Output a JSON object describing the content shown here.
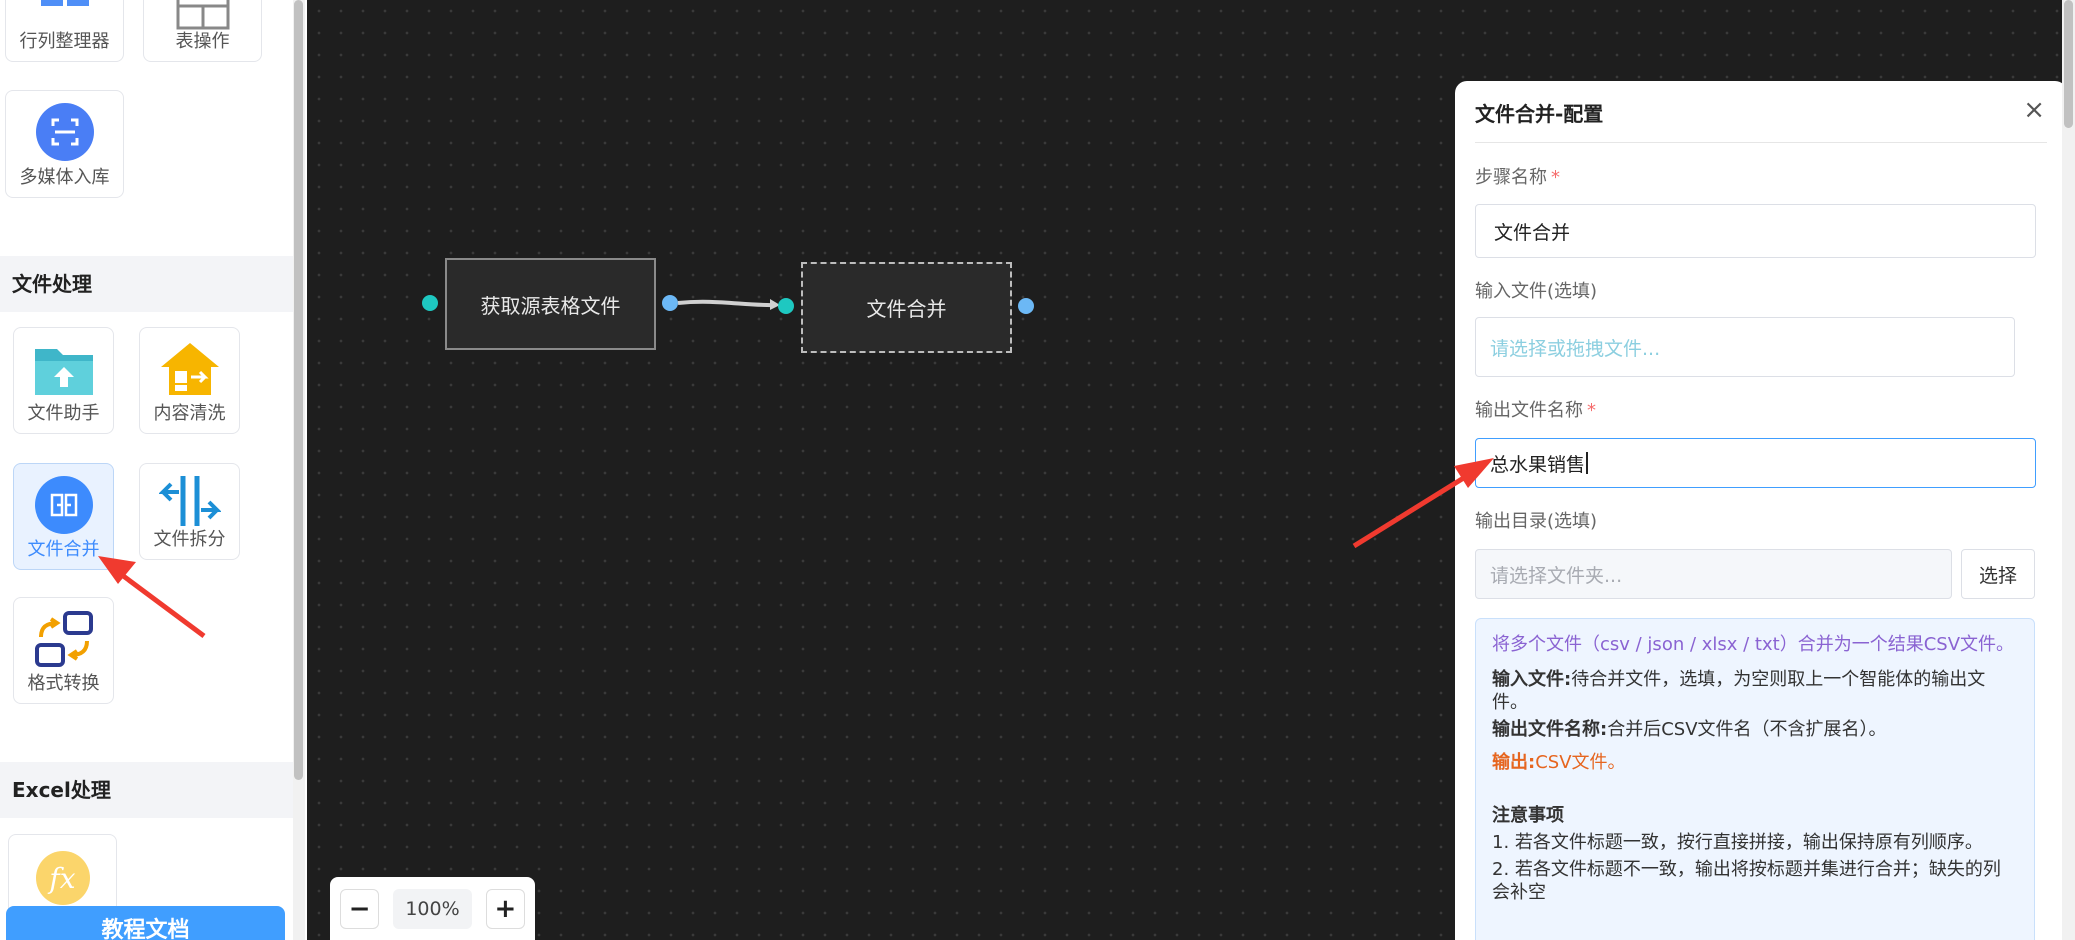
{
  "sidebar": {
    "top_tools": [
      {
        "label": "行列整理器"
      },
      {
        "label": "表操作"
      },
      {
        "label": "多媒体入库"
      }
    ],
    "sections": [
      {
        "title": "文件处理"
      },
      {
        "title": "Excel处理"
      }
    ],
    "file_tools": [
      {
        "label": "文件助手",
        "icon": "folder-upload-icon"
      },
      {
        "label": "内容清洗",
        "icon": "house-arrow-icon"
      },
      {
        "label": "文件合并",
        "icon": "merge-icon"
      },
      {
        "label": "文件拆分",
        "icon": "split-icon"
      },
      {
        "label": "格式转换",
        "icon": "convert-icon"
      }
    ],
    "excel_tools": [
      {
        "label": "fx",
        "icon": "function-icon"
      }
    ],
    "doc_button": "教程文档"
  },
  "canvas": {
    "nodes": [
      {
        "label": "获取源表格文件"
      },
      {
        "label": "文件合并"
      }
    ],
    "zoom": {
      "minus": "−",
      "value": "100%",
      "plus": "+"
    }
  },
  "panel": {
    "title": "文件合并-配置",
    "close": "×",
    "fields": {
      "step_name": {
        "label": "步骤名称",
        "required": "*",
        "value": "文件合并"
      },
      "input_file": {
        "label": "输入文件(选填)",
        "placeholder": "请选择或拖拽文件..."
      },
      "output_name": {
        "label": "输出文件名称",
        "required": "*",
        "value": "总水果销售"
      },
      "output_dir": {
        "label": "输出目录(选填)",
        "placeholder": "请选择文件夹...",
        "button": "选择"
      }
    },
    "info": {
      "summary": "将多个文件（csv / json / xlsx / txt）合并为一个结果CSV文件。",
      "input_key": "输入文件:",
      "input_desc": "待合并文件，选填，为空则取上一个智能体的输出文件。",
      "output_name_key": "输出文件名称:",
      "output_name_desc": "合并后CSV文件名（不含扩展名）。",
      "output_key": "输出:",
      "output_desc": "CSV文件。",
      "notes_title": "注意事项",
      "note1": "1. 若各文件标题一致，按行直接拼接，输出保持原有列顺序。",
      "note2": "2. 若各文件标题不一致，输出将按标题并集进行合并；缺失的列会补空"
    }
  },
  "colors": {
    "accent": "#409eff",
    "port_teal": "#1ec8c1",
    "port_blue": "#6cb8f5",
    "annotation_red": "#f03a2f"
  }
}
